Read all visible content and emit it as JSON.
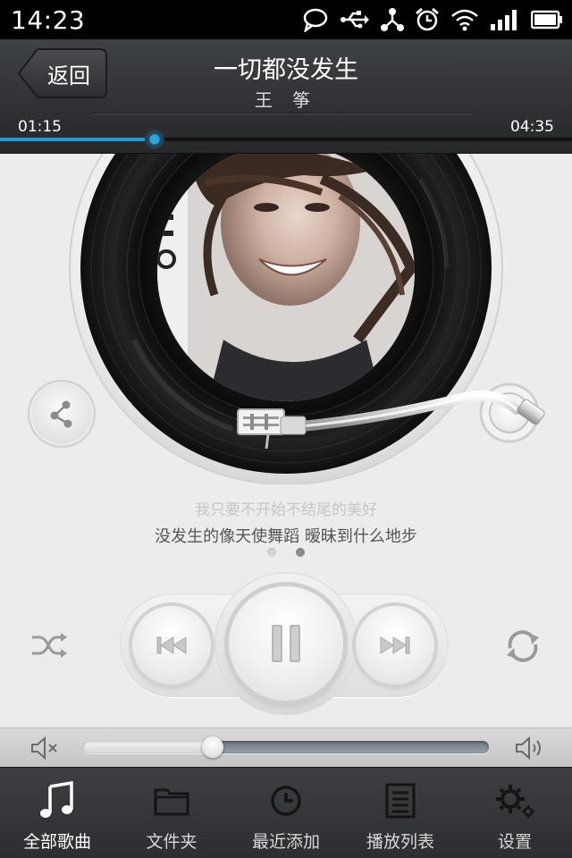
{
  "status_bar": {
    "time": "14:23",
    "icons": [
      "chat-icon",
      "usb-icon",
      "share-tether-icon",
      "alarm-icon",
      "wifi-icon",
      "signal-icon",
      "battery-icon"
    ]
  },
  "header": {
    "back_label": "返回",
    "song_title": "一切都没发生",
    "artist": "王 筝",
    "elapsed": "01:15",
    "total": "04:35",
    "progress_fraction": 0.27
  },
  "lyrics": {
    "previous_line": "我只要不开始不结尾的美好",
    "current_line": "没发生的像天使舞蹈 暧昧到什么地步"
  },
  "page_indicator": {
    "count": 2,
    "active_index": 1
  },
  "player": {
    "state": "playing",
    "shuffle_icon": "shuffle-icon",
    "repeat_icon": "repeat-icon",
    "prev_icon": "previous-track-icon",
    "pause_icon": "pause-icon",
    "next_icon": "next-track-icon"
  },
  "volume": {
    "level_fraction": 0.32
  },
  "nav": {
    "items": [
      {
        "label": "全部歌曲",
        "icon": "music-note-icon"
      },
      {
        "label": "文件夹",
        "icon": "folder-icon"
      },
      {
        "label": "最近添加",
        "icon": "clock-icon"
      },
      {
        "label": "播放列表",
        "icon": "playlist-icon"
      },
      {
        "label": "设置",
        "icon": "gear-icon"
      }
    ]
  },
  "colors": {
    "accent": "#1f9ad6",
    "header_bg": "#333538",
    "page_bg": "#ececec",
    "nav_bg": "#333538"
  }
}
